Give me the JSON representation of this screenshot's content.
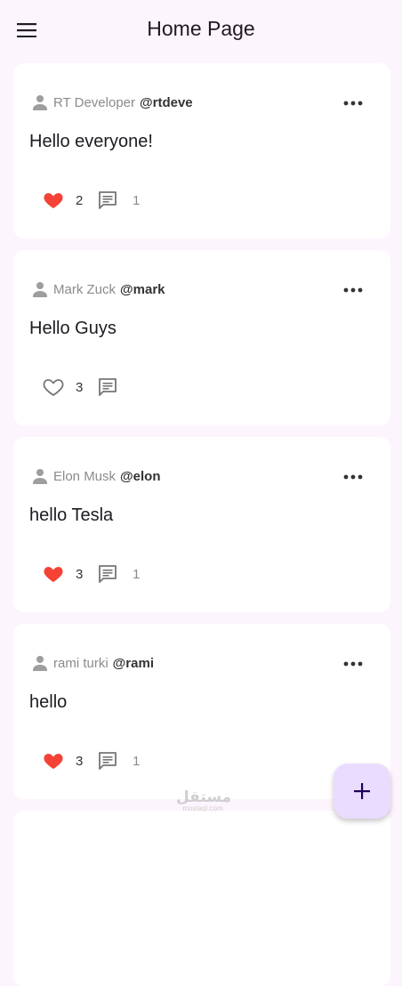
{
  "appbar": {
    "title": "Home Page",
    "menu_icon": "menu-icon"
  },
  "posts": [
    {
      "author": "RT Developer",
      "handle": "@rtdeve",
      "text": "Hello everyone!",
      "liked": true,
      "likes": "2",
      "comments": "1"
    },
    {
      "author": "Mark Zuck",
      "handle": "@mark",
      "text": "Hello Guys",
      "liked": false,
      "likes": "3",
      "comments": ""
    },
    {
      "author": "Elon Musk",
      "handle": "@elon",
      "text": "hello Tesla",
      "liked": true,
      "likes": "3",
      "comments": "1"
    },
    {
      "author": "rami turki",
      "handle": "@rami",
      "text": "hello",
      "liked": true,
      "likes": "3",
      "comments": "1"
    }
  ],
  "fab": {
    "icon": "add-icon"
  },
  "watermark": {
    "logo": "مستقل",
    "domain": "mostaql.com"
  },
  "colors": {
    "background": "#fdf5fd",
    "card": "#ffffff",
    "like_active": "#f44336",
    "icon_grey": "#757575",
    "fab": "#eadcff"
  }
}
